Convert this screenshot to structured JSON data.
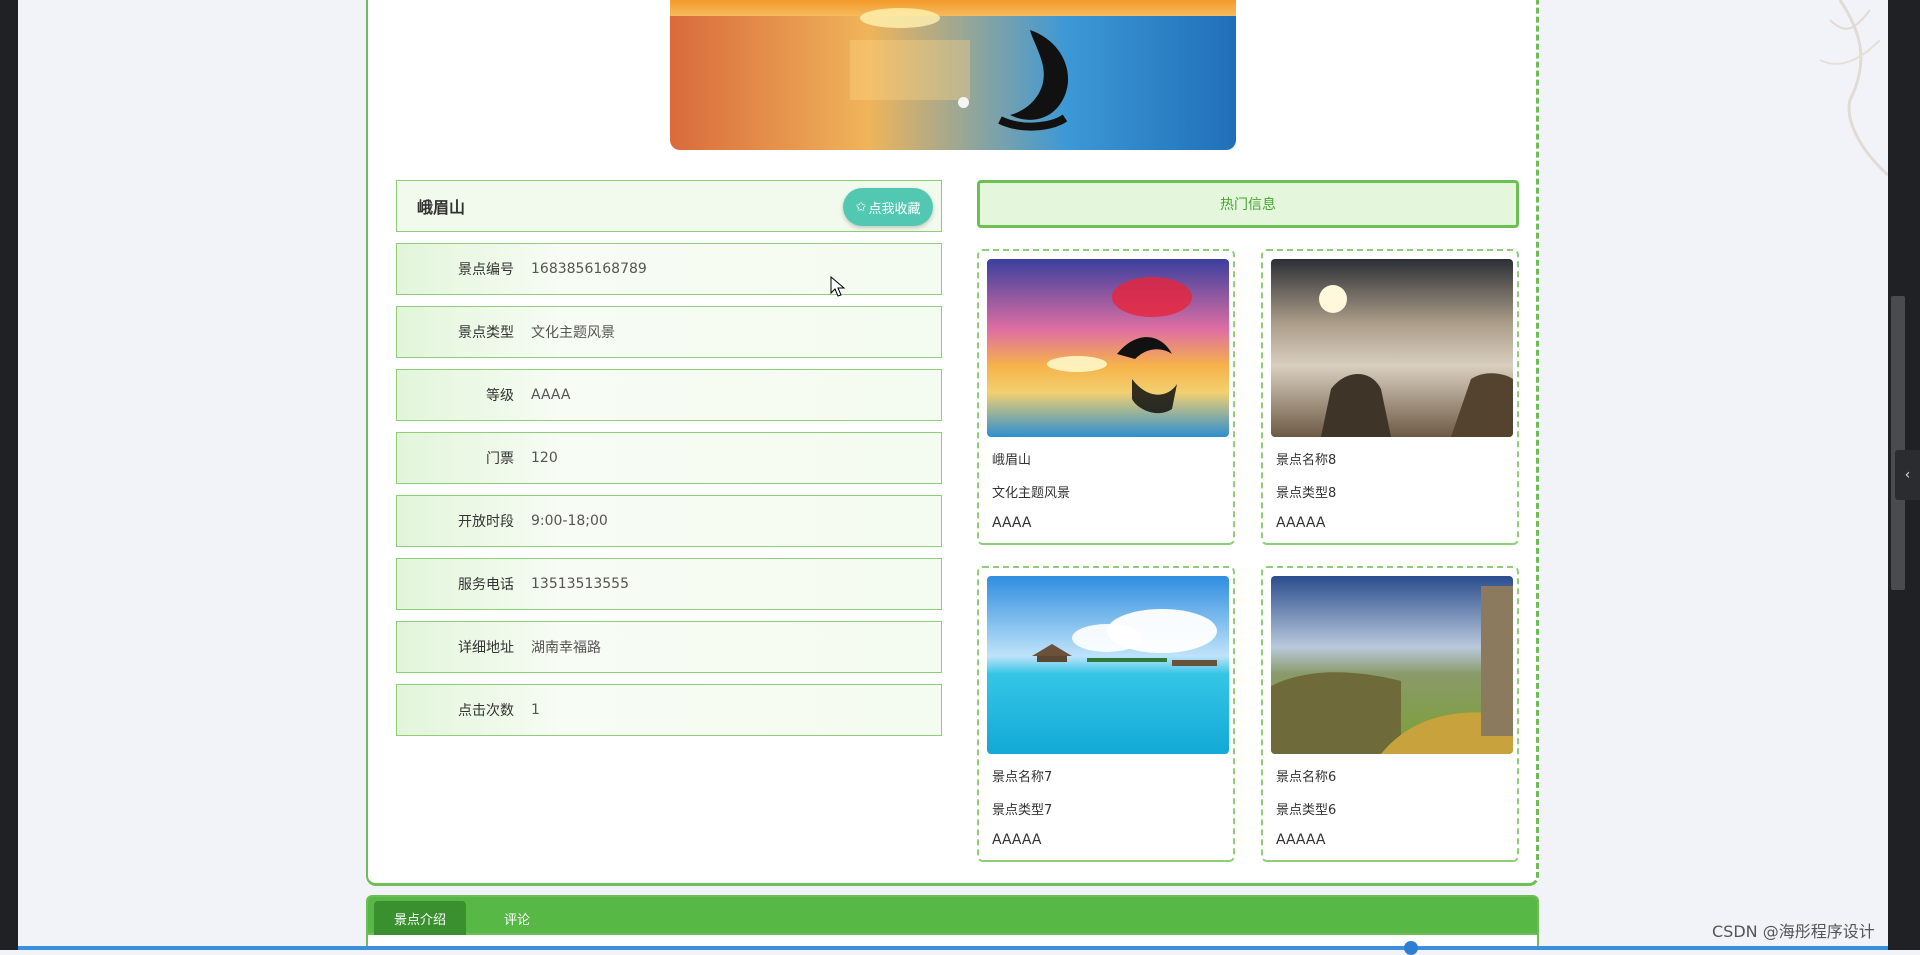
{
  "spot": {
    "title": "峨眉山",
    "favorite_label": "点我收藏",
    "fields": [
      {
        "label": "景点编号",
        "value": "1683856168789"
      },
      {
        "label": "景点类型",
        "value": "文化主题风景"
      },
      {
        "label": "等级",
        "value": "AAAA"
      },
      {
        "label": "门票",
        "value": "120"
      },
      {
        "label": "开放时段",
        "value": "9:00-18;00"
      },
      {
        "label": "服务电话",
        "value": "13513513555"
      },
      {
        "label": "详细地址",
        "value": "湖南幸福路"
      },
      {
        "label": "点击次数",
        "value": "1"
      }
    ]
  },
  "hot": {
    "title": "热门信息",
    "cards": [
      {
        "name": "峨眉山",
        "type": "文化主题风景",
        "level": "AAAA"
      },
      {
        "name": "景点名称8",
        "type": "景点类型8",
        "level": "AAAAA"
      },
      {
        "name": "景点名称7",
        "type": "景点类型7",
        "level": "AAAAA"
      },
      {
        "name": "景点名称6",
        "type": "景点类型6",
        "level": "AAAAA"
      }
    ]
  },
  "tabs": {
    "intro": "景点介绍",
    "comment": "评论"
  },
  "watermark": "CSDN @海彤程序设计",
  "colors": {
    "accent": "#6fbe55",
    "tab_bar": "#57b846",
    "favorite_button": "#52c8b3"
  }
}
